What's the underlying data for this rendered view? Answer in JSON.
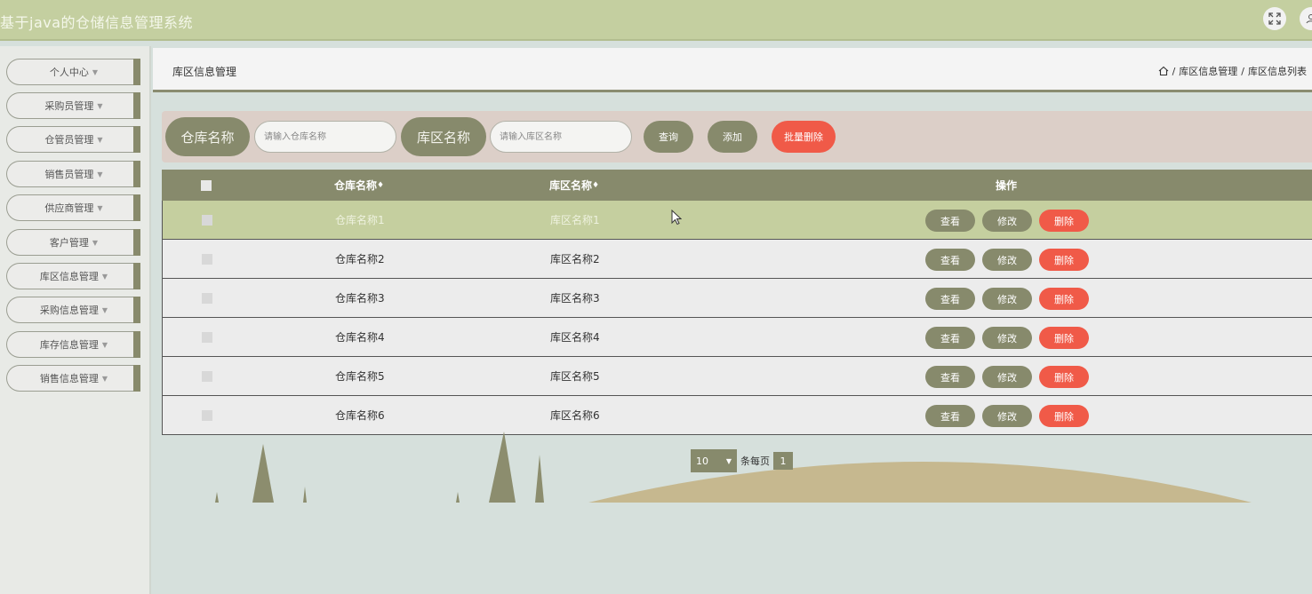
{
  "header": {
    "title": "基于java的仓储信息管理系统"
  },
  "sidebar": {
    "items": [
      {
        "label": "个人中心"
      },
      {
        "label": "采购员管理"
      },
      {
        "label": "仓管员管理"
      },
      {
        "label": "销售员管理"
      },
      {
        "label": "供应商管理"
      },
      {
        "label": "客户管理"
      },
      {
        "label": "库区信息管理"
      },
      {
        "label": "采购信息管理"
      },
      {
        "label": "库存信息管理"
      },
      {
        "label": "销售信息管理"
      }
    ]
  },
  "page": {
    "title": "库区信息管理",
    "breadcrumb": [
      "库区信息管理",
      "库区信息列表"
    ],
    "breadcrumb_sep": "/"
  },
  "search": {
    "warehouse_label": "仓库名称",
    "warehouse_placeholder": "请输入仓库名称",
    "zone_label": "库区名称",
    "zone_placeholder": "请输入库区名称",
    "query_label": "查询",
    "add_label": "添加",
    "batch_delete_label": "批量删除"
  },
  "table": {
    "columns": [
      "仓库名称",
      "库区名称",
      "操作"
    ],
    "sort_marker": "♦",
    "rows": [
      {
        "warehouse": "仓库名称1",
        "zone": "库区名称1"
      },
      {
        "warehouse": "仓库名称2",
        "zone": "库区名称2"
      },
      {
        "warehouse": "仓库名称3",
        "zone": "库区名称3"
      },
      {
        "warehouse": "仓库名称4",
        "zone": "库区名称4"
      },
      {
        "warehouse": "仓库名称5",
        "zone": "库区名称5"
      },
      {
        "warehouse": "仓库名称6",
        "zone": "库区名称6"
      }
    ],
    "actions": {
      "view": "查看",
      "edit": "修改",
      "delete": "删除"
    }
  },
  "pagination": {
    "page_size": "10",
    "per_page_label": "条每页",
    "current_page": "1"
  },
  "colors": {
    "accent": "#878a6c",
    "danger": "#f05a48",
    "header_bg": "#c4cfa0",
    "highlight_row": "#c5cf9f"
  }
}
